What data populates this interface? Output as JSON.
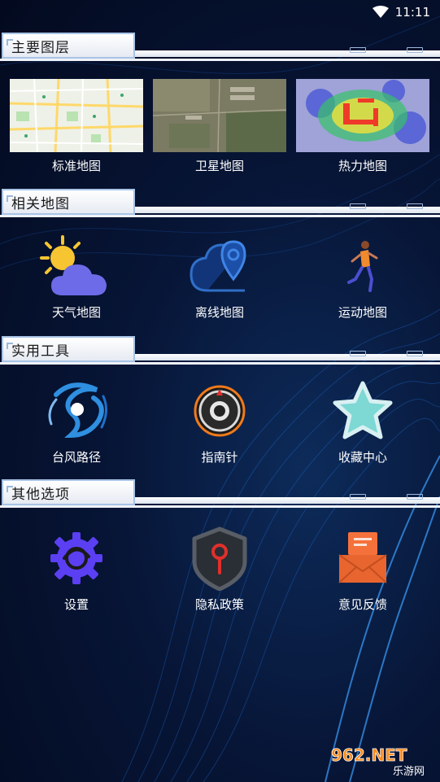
{
  "status_bar": {
    "time": "11:11"
  },
  "sections": {
    "layers": {
      "title": "主要图层"
    },
    "related": {
      "title": "相关地图"
    },
    "tools": {
      "title": "实用工具"
    },
    "other": {
      "title": "其他选项"
    }
  },
  "layers": [
    {
      "label": "标准地图",
      "icon": "standard-map-thumbnail"
    },
    {
      "label": "卫星地图",
      "icon": "satellite-map-thumbnail"
    },
    {
      "label": "热力地图",
      "icon": "heat-map-thumbnail"
    }
  ],
  "related": [
    {
      "label": "天气地图",
      "icon": "weather-icon"
    },
    {
      "label": "离线地图",
      "icon": "offline-map-icon"
    },
    {
      "label": "运动地图",
      "icon": "runner-icon"
    }
  ],
  "tools": [
    {
      "label": "台风路径",
      "icon": "typhoon-icon"
    },
    {
      "label": "指南针",
      "icon": "compass-icon"
    },
    {
      "label": "收藏中心",
      "icon": "star-icon"
    }
  ],
  "other": [
    {
      "label": "设置",
      "icon": "settings-gear-icon"
    },
    {
      "label": "隐私政策",
      "icon": "privacy-shield-icon"
    },
    {
      "label": "意见反馈",
      "icon": "feedback-mail-icon"
    }
  ],
  "watermark": {
    "text_top": "962.NET",
    "text_bottom": "乐游网"
  },
  "colors": {
    "background": "#071536",
    "weather_cloud": "#6e6be8",
    "sun": "#f7c531",
    "offline_map": "#2f6fc9",
    "runner_shirt": "#f28a2e",
    "typhoon": "#2f8fe0",
    "compass_ring": "#f07a1a",
    "star_fill": "#7ed8d4",
    "settings_gear": "#5b3ff2",
    "privacy_shield": "#595e66",
    "privacy_key": "#e0302b",
    "feedback_mail": "#f5713b"
  }
}
